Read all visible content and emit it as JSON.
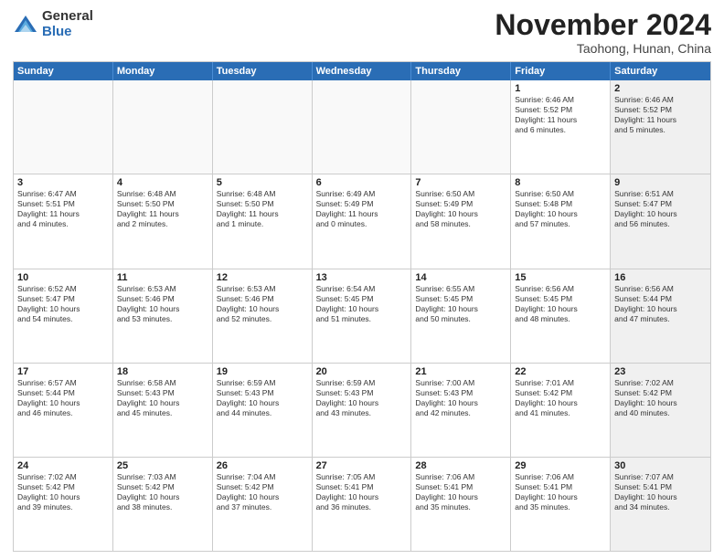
{
  "logo": {
    "general": "General",
    "blue": "Blue"
  },
  "header": {
    "month": "November 2024",
    "location": "Taohong, Hunan, China"
  },
  "weekdays": [
    "Sunday",
    "Monday",
    "Tuesday",
    "Wednesday",
    "Thursday",
    "Friday",
    "Saturday"
  ],
  "weeks": [
    [
      {
        "day": "",
        "empty": true
      },
      {
        "day": "",
        "empty": true
      },
      {
        "day": "",
        "empty": true
      },
      {
        "day": "",
        "empty": true
      },
      {
        "day": "",
        "empty": true
      },
      {
        "day": "1",
        "lines": [
          "Sunrise: 6:46 AM",
          "Sunset: 5:52 PM",
          "Daylight: 11 hours",
          "and 6 minutes."
        ]
      },
      {
        "day": "2",
        "lines": [
          "Sunrise: 6:46 AM",
          "Sunset: 5:52 PM",
          "Daylight: 11 hours",
          "and 5 minutes."
        ],
        "shaded": true
      }
    ],
    [
      {
        "day": "3",
        "lines": [
          "Sunrise: 6:47 AM",
          "Sunset: 5:51 PM",
          "Daylight: 11 hours",
          "and 4 minutes."
        ]
      },
      {
        "day": "4",
        "lines": [
          "Sunrise: 6:48 AM",
          "Sunset: 5:50 PM",
          "Daylight: 11 hours",
          "and 2 minutes."
        ]
      },
      {
        "day": "5",
        "lines": [
          "Sunrise: 6:48 AM",
          "Sunset: 5:50 PM",
          "Daylight: 11 hours",
          "and 1 minute."
        ]
      },
      {
        "day": "6",
        "lines": [
          "Sunrise: 6:49 AM",
          "Sunset: 5:49 PM",
          "Daylight: 11 hours",
          "and 0 minutes."
        ]
      },
      {
        "day": "7",
        "lines": [
          "Sunrise: 6:50 AM",
          "Sunset: 5:49 PM",
          "Daylight: 10 hours",
          "and 58 minutes."
        ]
      },
      {
        "day": "8",
        "lines": [
          "Sunrise: 6:50 AM",
          "Sunset: 5:48 PM",
          "Daylight: 10 hours",
          "and 57 minutes."
        ]
      },
      {
        "day": "9",
        "lines": [
          "Sunrise: 6:51 AM",
          "Sunset: 5:47 PM",
          "Daylight: 10 hours",
          "and 56 minutes."
        ],
        "shaded": true
      }
    ],
    [
      {
        "day": "10",
        "lines": [
          "Sunrise: 6:52 AM",
          "Sunset: 5:47 PM",
          "Daylight: 10 hours",
          "and 54 minutes."
        ]
      },
      {
        "day": "11",
        "lines": [
          "Sunrise: 6:53 AM",
          "Sunset: 5:46 PM",
          "Daylight: 10 hours",
          "and 53 minutes."
        ]
      },
      {
        "day": "12",
        "lines": [
          "Sunrise: 6:53 AM",
          "Sunset: 5:46 PM",
          "Daylight: 10 hours",
          "and 52 minutes."
        ]
      },
      {
        "day": "13",
        "lines": [
          "Sunrise: 6:54 AM",
          "Sunset: 5:45 PM",
          "Daylight: 10 hours",
          "and 51 minutes."
        ]
      },
      {
        "day": "14",
        "lines": [
          "Sunrise: 6:55 AM",
          "Sunset: 5:45 PM",
          "Daylight: 10 hours",
          "and 50 minutes."
        ]
      },
      {
        "day": "15",
        "lines": [
          "Sunrise: 6:56 AM",
          "Sunset: 5:45 PM",
          "Daylight: 10 hours",
          "and 48 minutes."
        ]
      },
      {
        "day": "16",
        "lines": [
          "Sunrise: 6:56 AM",
          "Sunset: 5:44 PM",
          "Daylight: 10 hours",
          "and 47 minutes."
        ],
        "shaded": true
      }
    ],
    [
      {
        "day": "17",
        "lines": [
          "Sunrise: 6:57 AM",
          "Sunset: 5:44 PM",
          "Daylight: 10 hours",
          "and 46 minutes."
        ]
      },
      {
        "day": "18",
        "lines": [
          "Sunrise: 6:58 AM",
          "Sunset: 5:43 PM",
          "Daylight: 10 hours",
          "and 45 minutes."
        ]
      },
      {
        "day": "19",
        "lines": [
          "Sunrise: 6:59 AM",
          "Sunset: 5:43 PM",
          "Daylight: 10 hours",
          "and 44 minutes."
        ]
      },
      {
        "day": "20",
        "lines": [
          "Sunrise: 6:59 AM",
          "Sunset: 5:43 PM",
          "Daylight: 10 hours",
          "and 43 minutes."
        ]
      },
      {
        "day": "21",
        "lines": [
          "Sunrise: 7:00 AM",
          "Sunset: 5:43 PM",
          "Daylight: 10 hours",
          "and 42 minutes."
        ]
      },
      {
        "day": "22",
        "lines": [
          "Sunrise: 7:01 AM",
          "Sunset: 5:42 PM",
          "Daylight: 10 hours",
          "and 41 minutes."
        ]
      },
      {
        "day": "23",
        "lines": [
          "Sunrise: 7:02 AM",
          "Sunset: 5:42 PM",
          "Daylight: 10 hours",
          "and 40 minutes."
        ],
        "shaded": true
      }
    ],
    [
      {
        "day": "24",
        "lines": [
          "Sunrise: 7:02 AM",
          "Sunset: 5:42 PM",
          "Daylight: 10 hours",
          "and 39 minutes."
        ]
      },
      {
        "day": "25",
        "lines": [
          "Sunrise: 7:03 AM",
          "Sunset: 5:42 PM",
          "Daylight: 10 hours",
          "and 38 minutes."
        ]
      },
      {
        "day": "26",
        "lines": [
          "Sunrise: 7:04 AM",
          "Sunset: 5:42 PM",
          "Daylight: 10 hours",
          "and 37 minutes."
        ]
      },
      {
        "day": "27",
        "lines": [
          "Sunrise: 7:05 AM",
          "Sunset: 5:41 PM",
          "Daylight: 10 hours",
          "and 36 minutes."
        ]
      },
      {
        "day": "28",
        "lines": [
          "Sunrise: 7:06 AM",
          "Sunset: 5:41 PM",
          "Daylight: 10 hours",
          "and 35 minutes."
        ]
      },
      {
        "day": "29",
        "lines": [
          "Sunrise: 7:06 AM",
          "Sunset: 5:41 PM",
          "Daylight: 10 hours",
          "and 35 minutes."
        ]
      },
      {
        "day": "30",
        "lines": [
          "Sunrise: 7:07 AM",
          "Sunset: 5:41 PM",
          "Daylight: 10 hours",
          "and 34 minutes."
        ],
        "shaded": true
      }
    ]
  ]
}
